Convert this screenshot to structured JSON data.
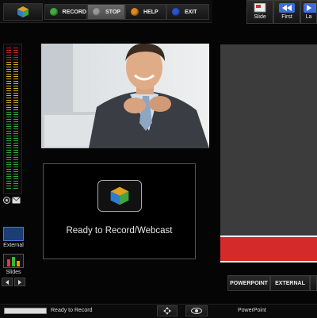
{
  "toolbar": {
    "buttons": [
      {
        "label": "RECORD",
        "color": "#3fae3f"
      },
      {
        "label": "STOP",
        "color": "#9a9a9a"
      },
      {
        "label": "HELP",
        "color": "#e08a1e"
      },
      {
        "label": "EXIT",
        "color": "#2a55d6"
      }
    ]
  },
  "nav": {
    "slide_label": "Slide",
    "first_label": "First",
    "last_label": "La"
  },
  "preview": {
    "status_text": "Ready to Record/Webcast"
  },
  "source_buttons": {
    "external_label": "External",
    "slides_label": "Slides"
  },
  "tabs": {
    "powerpoint_label": "POWERPOINT",
    "external_label": "EXTERNAL"
  },
  "statusbar": {
    "status_text": "Ready to Record",
    "source_text": "PowerPoint",
    "progress": 1.0
  },
  "colors": {
    "slide_area": "#3c3c3c",
    "slide_bar": "#d52a2a"
  }
}
